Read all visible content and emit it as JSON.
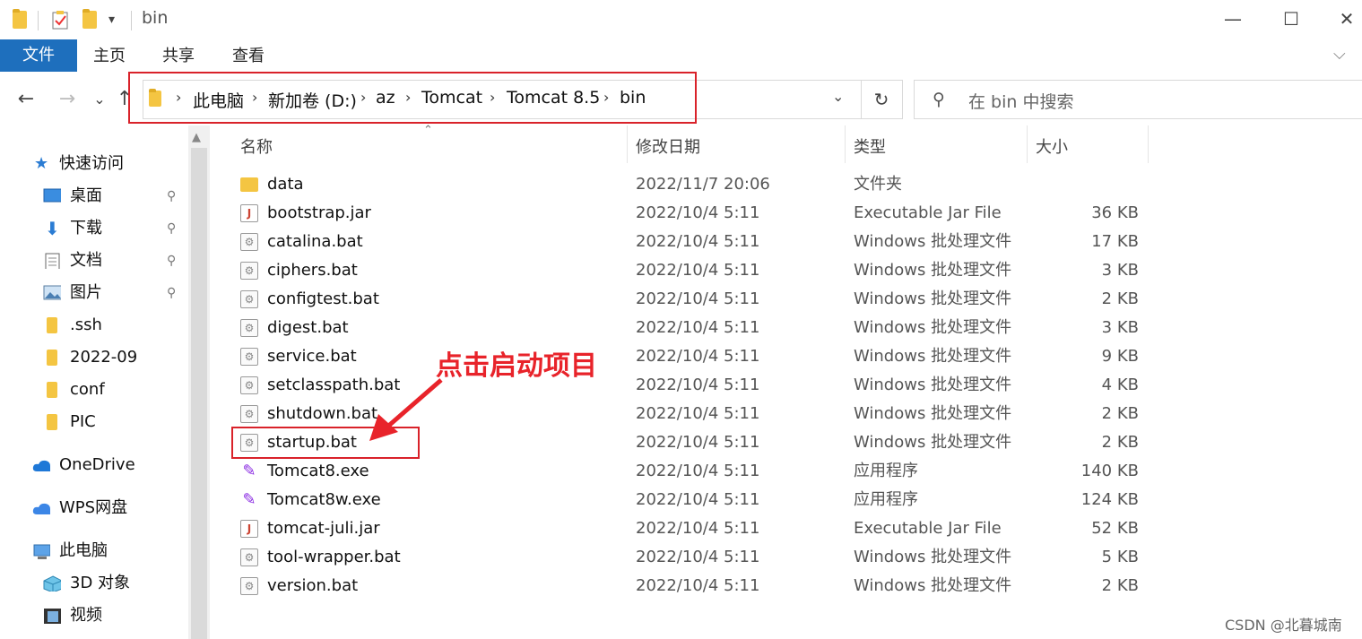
{
  "window": {
    "title": "bin",
    "min_glyph": "—",
    "max_glyph": "☐",
    "close_glyph": "✕",
    "expand_glyph": "⌵"
  },
  "ribbon": {
    "tabs": [
      "文件",
      "主页",
      "共享",
      "查看"
    ]
  },
  "nav": {
    "back": "←",
    "forward": "→",
    "recent": "⌄",
    "up": "↑",
    "breadcrumb": [
      "此电脑",
      "新加卷 (D:)",
      "az",
      "Tomcat",
      "Tomcat 8.5",
      "bin"
    ],
    "sep": "›",
    "dropdown": "⌄",
    "refresh": "↻",
    "search_placeholder": "在 bin 中搜索",
    "search_icon": "⚲"
  },
  "sidebar": {
    "items": [
      {
        "label": "快速访问",
        "icon": "star-icon",
        "pinned": false
      },
      {
        "label": "桌面",
        "icon": "desktop-icon",
        "pinned": true
      },
      {
        "label": "下载",
        "icon": "download-icon",
        "pinned": true
      },
      {
        "label": "文档",
        "icon": "document-icon",
        "pinned": true
      },
      {
        "label": "图片",
        "icon": "picture-icon",
        "pinned": true
      },
      {
        "label": ".ssh",
        "icon": "folder-icon",
        "pinned": false
      },
      {
        "label": "2022-09",
        "icon": "folder-icon",
        "pinned": false
      },
      {
        "label": "conf",
        "icon": "folder-icon",
        "pinned": false
      },
      {
        "label": "PIC",
        "icon": "folder-icon",
        "pinned": false
      },
      {
        "label": "OneDrive",
        "icon": "cloud-icon",
        "pinned": false
      },
      {
        "label": "WPS网盘",
        "icon": "cloud-icon",
        "pinned": false
      },
      {
        "label": "此电脑",
        "icon": "computer-icon",
        "pinned": false
      },
      {
        "label": "3D 对象",
        "icon": "cube-icon",
        "pinned": false
      },
      {
        "label": "视频",
        "icon": "video-icon",
        "pinned": false
      }
    ],
    "pin_glyph": "📌",
    "scroll_up": "▲"
  },
  "columns": {
    "name": "名称",
    "date": "修改日期",
    "type": "类型",
    "size": "大小",
    "sort_glyph": "⌃"
  },
  "files": [
    {
      "name": "data",
      "date": "2022/11/7 20:06",
      "type": "文件夹",
      "size": "",
      "icon": "folder-icon"
    },
    {
      "name": "bootstrap.jar",
      "date": "2022/10/4 5:11",
      "type": "Executable Jar File",
      "size": "36 KB",
      "icon": "jar-icon"
    },
    {
      "name": "catalina.bat",
      "date": "2022/10/4 5:11",
      "type": "Windows 批处理文件",
      "size": "17 KB",
      "icon": "batch-icon"
    },
    {
      "name": "ciphers.bat",
      "date": "2022/10/4 5:11",
      "type": "Windows 批处理文件",
      "size": "3 KB",
      "icon": "batch-icon"
    },
    {
      "name": "configtest.bat",
      "date": "2022/10/4 5:11",
      "type": "Windows 批处理文件",
      "size": "2 KB",
      "icon": "batch-icon"
    },
    {
      "name": "digest.bat",
      "date": "2022/10/4 5:11",
      "type": "Windows 批处理文件",
      "size": "3 KB",
      "icon": "batch-icon"
    },
    {
      "name": "service.bat",
      "date": "2022/10/4 5:11",
      "type": "Windows 批处理文件",
      "size": "9 KB",
      "icon": "batch-icon"
    },
    {
      "name": "setclasspath.bat",
      "date": "2022/10/4 5:11",
      "type": "Windows 批处理文件",
      "size": "4 KB",
      "icon": "batch-icon"
    },
    {
      "name": "shutdown.bat",
      "date": "2022/10/4 5:11",
      "type": "Windows 批处理文件",
      "size": "2 KB",
      "icon": "batch-icon"
    },
    {
      "name": "startup.bat",
      "date": "2022/10/4 5:11",
      "type": "Windows 批处理文件",
      "size": "2 KB",
      "icon": "batch-icon"
    },
    {
      "name": "Tomcat8.exe",
      "date": "2022/10/4 5:11",
      "type": "应用程序",
      "size": "140 KB",
      "icon": "tomcat-icon"
    },
    {
      "name": "Tomcat8w.exe",
      "date": "2022/10/4 5:11",
      "type": "应用程序",
      "size": "124 KB",
      "icon": "tomcat-icon"
    },
    {
      "name": "tomcat-juli.jar",
      "date": "2022/10/4 5:11",
      "type": "Executable Jar File",
      "size": "52 KB",
      "icon": "jar-icon"
    },
    {
      "name": "tool-wrapper.bat",
      "date": "2022/10/4 5:11",
      "type": "Windows 批处理文件",
      "size": "5 KB",
      "icon": "batch-icon"
    },
    {
      "name": "version.bat",
      "date": "2022/10/4 5:11",
      "type": "Windows 批处理文件",
      "size": "2 KB",
      "icon": "batch-icon"
    }
  ],
  "annotation": {
    "text": "点击启动项目",
    "color": "#e8232a"
  },
  "watermark": "CSDN @北暮城南",
  "colors": {
    "accent": "#1e6fbd",
    "highlight_box": "#d9222a"
  }
}
